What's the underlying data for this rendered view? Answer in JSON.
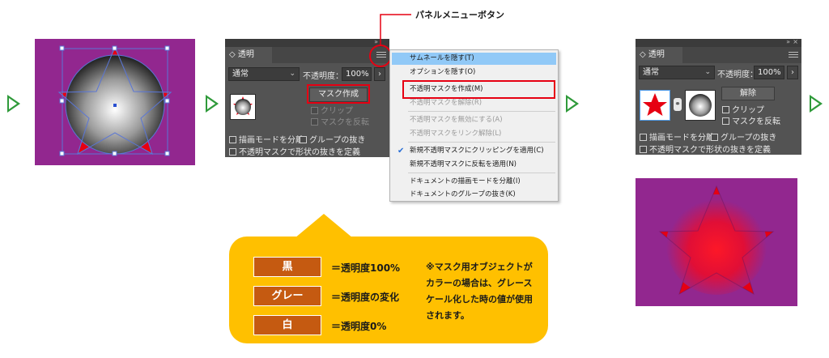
{
  "callout": {
    "label": "パネルメニューボタン"
  },
  "panel_left": {
    "tab": "透明",
    "blend_mode": "通常",
    "opacity_label": "不透明度：",
    "opacity_value": "100%",
    "make_mask": "マスク作成",
    "clip": "クリップ",
    "invert": "マスクを反転",
    "isolate_blending": "描画モードを分離",
    "knockout_group": "グループの抜き",
    "opacity_mask_knockout": "不透明マスクで形状の抜きを定義",
    "tab_arrow": "◇",
    "collapse": "»"
  },
  "panel_right": {
    "tab": "透明",
    "blend_mode": "通常",
    "opacity_label": "不透明度：",
    "opacity_value": "100%",
    "release": "解除",
    "clip": "クリップ",
    "invert": "マスクを反転",
    "isolate_blending": "描画モードを分離",
    "knockout_group": "グループの抜き",
    "opacity_mask_knockout": "不透明マスクで形状の抜きを定義",
    "tab_arrow": "◇",
    "collapse": "»",
    "close": "×"
  },
  "menu": {
    "items": [
      {
        "label": "サムネールを隠す(T)"
      },
      {
        "label": "オプションを隠す(O)"
      },
      {
        "label": "不透明マスクを作成(M)"
      },
      {
        "label": "不透明マスクを解除(R)"
      },
      {
        "label": "不透明マスクを無効にする(A)"
      },
      {
        "label": "不透明マスクをリンク解除(L)"
      },
      {
        "label": "新規不透明マスクにクリッピングを適用(C)"
      },
      {
        "label": "新規不透明マスクに反転を適用(N)"
      },
      {
        "label": "ドキュメントの描画モードを分離(I)"
      },
      {
        "label": "ドキュメントのグループの抜き(K)"
      }
    ]
  },
  "legend": {
    "black_key": "黒",
    "black_value": "＝透明度100%",
    "gray_key": "グレー",
    "gray_value": "＝透明度の変化",
    "white_key": "白",
    "white_value": "＝透明度0%",
    "note": "※マスク用オブジェクトがカラーの場合は、グレースケール化した時の値が使用されます。"
  },
  "colors": {
    "artboard": "#92278f",
    "panel": "#535353",
    "star": "#e60012",
    "highlight": "#e60012",
    "info_box": "#ffc000",
    "legend_key": "#c55a11",
    "flow_arrow": "#2f9a3a"
  },
  "icons": {
    "flow": "play-triangle-icon",
    "menu": "hamburger-icon",
    "check": "checkmark-icon",
    "link": "chain-link-icon"
  }
}
